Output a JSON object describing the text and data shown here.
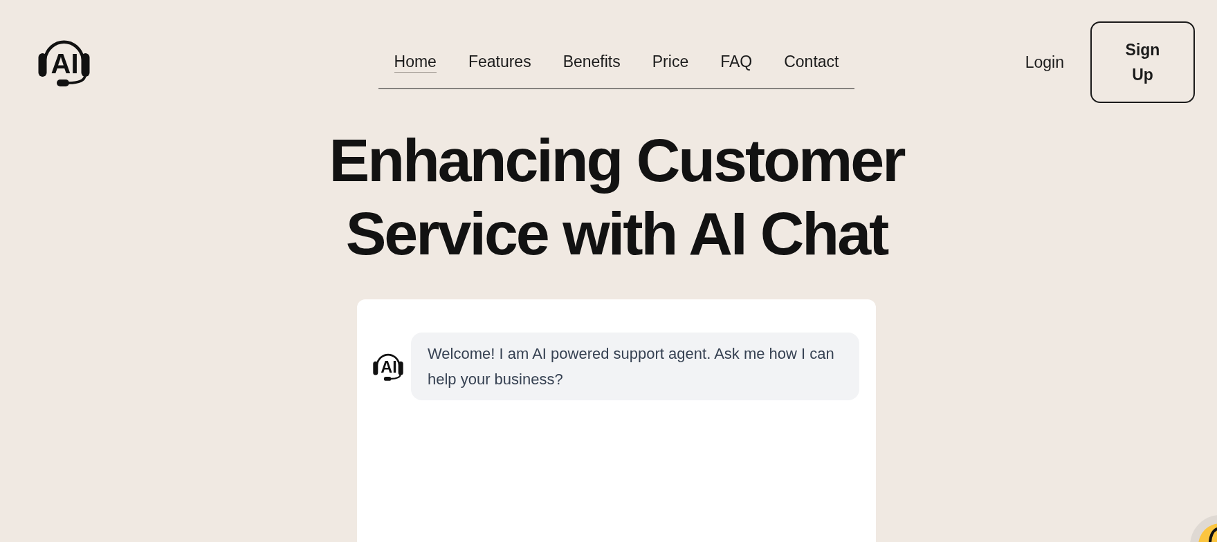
{
  "logo": {
    "text": "AI"
  },
  "nav": {
    "items": [
      {
        "label": "Home",
        "selected": true
      },
      {
        "label": "Features",
        "selected": false
      },
      {
        "label": "Benefits",
        "selected": false
      },
      {
        "label": "Price",
        "selected": false
      },
      {
        "label": "FAQ",
        "selected": false
      },
      {
        "label": "Contact",
        "selected": false
      }
    ]
  },
  "auth": {
    "login": "Login",
    "signup": "Sign Up"
  },
  "hero": {
    "title": "Enhancing Customer Service with AI Chat"
  },
  "chat": {
    "avatar_text": "AI",
    "messages": [
      {
        "kind": "bot",
        "text": "Welcome! I am AI powered support agent. Ask me how I can help your business?"
      }
    ]
  }
}
